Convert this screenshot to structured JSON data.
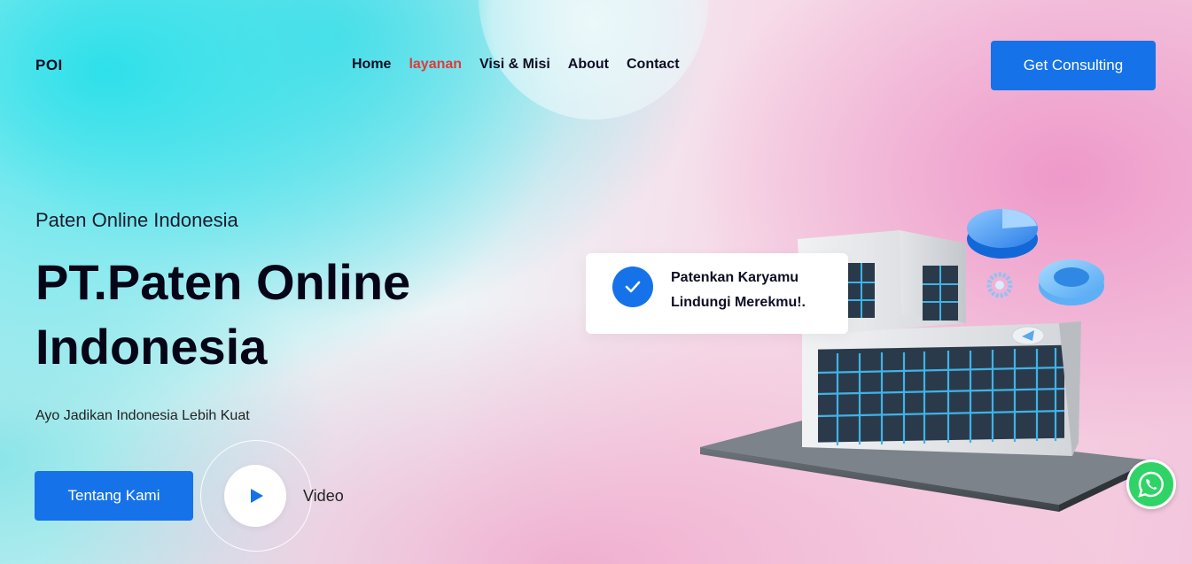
{
  "header": {
    "logo": "POI",
    "nav": [
      {
        "label": "Home",
        "active": false
      },
      {
        "label": "layanan",
        "active": true
      },
      {
        "label": "Visi & Misi",
        "active": false
      },
      {
        "label": "About",
        "active": false
      },
      {
        "label": "Contact",
        "active": false
      }
    ],
    "cta_label": "Get Consulting"
  },
  "hero": {
    "subtitle": "Paten Online Indonesia",
    "title": "PT.Paten Online Indonesia",
    "tagline": "Ayo Jadikan Indonesia Lebih Kuat",
    "primary_button": "Tentang Kami",
    "video_label": "Video"
  },
  "card": {
    "line1": "Patenkan Karyamu",
    "line2": "Lindungi Merekmu!."
  },
  "colors": {
    "accent": "#1672e8",
    "active_nav": "#e03a3a",
    "whatsapp": "#2fd366"
  },
  "icons": [
    "check-icon",
    "play-icon",
    "whatsapp-icon"
  ]
}
